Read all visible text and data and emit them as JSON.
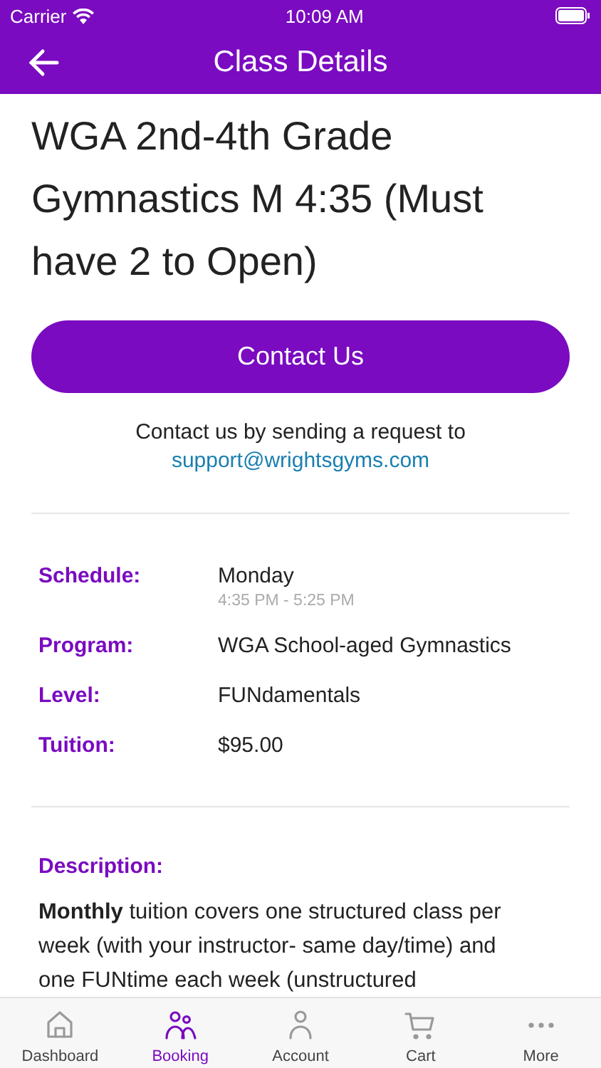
{
  "status_bar": {
    "carrier": "Carrier",
    "time": "10:09 AM"
  },
  "nav_bar": {
    "title": "Class Details"
  },
  "class_title": "WGA 2nd-4th Grade Gymnastics M 4:35 (Must have 2 to Open)",
  "contact": {
    "button": "Contact Us",
    "note": "Contact us by sending a request to",
    "email": "support@wrightsgyms.com"
  },
  "details": [
    {
      "label": "Schedule:",
      "value": "Monday",
      "sub": "4:35 PM - 5:25 PM"
    },
    {
      "label": "Program:",
      "value": "WGA School-aged Gymnastics"
    },
    {
      "label": "Level:",
      "value": "FUNdamentals"
    },
    {
      "label": "Tuition:",
      "value": "$95.00"
    }
  ],
  "description": {
    "label": "Description:",
    "text": "**Monthly** tuition covers one structured class per week (with your instructor- same day/time) and one FUNtime each week (unstructured"
  },
  "tab_bar": [
    {
      "kind": "home",
      "label": "Dashboard",
      "selected": false
    },
    {
      "kind": "people",
      "label": "Booking",
      "selected": true
    },
    {
      "kind": "person",
      "label": "Account",
      "selected": false
    },
    {
      "kind": "cart",
      "label": "Cart",
      "selected": false
    },
    {
      "kind": "more",
      "label": "More",
      "selected": false
    }
  ]
}
